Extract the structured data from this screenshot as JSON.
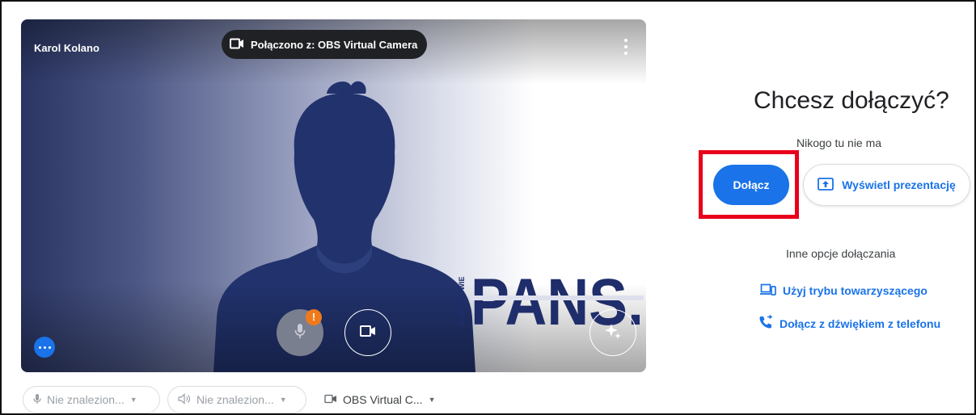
{
  "preview": {
    "participant_name": "Karol Kolano",
    "camera_status": "Połączono z: OBS Virtual Camera",
    "logo_text": "PANS.",
    "logo_subtext": "W GŁOGOWIE",
    "mic_alert": "!"
  },
  "devices": {
    "microphone": "Nie znalezion...",
    "speaker": "Nie znalezion...",
    "camera": "OBS Virtual C..."
  },
  "join_panel": {
    "title": "Chcesz dołączyć?",
    "status": "Nikogo tu nie ma",
    "join_label": "Dołącz",
    "present_label": "Wyświetl prezentację",
    "other_options_label": "Inne opcje dołączania",
    "companion_label": "Użyj trybu towarzyszącego",
    "phone_label": "Dołącz z dźwiękiem z telefonu"
  },
  "colors": {
    "accent": "#1a73e8",
    "highlight": "#e8001c",
    "alert": "#f07a1a",
    "logo": "#1f2d6b"
  }
}
